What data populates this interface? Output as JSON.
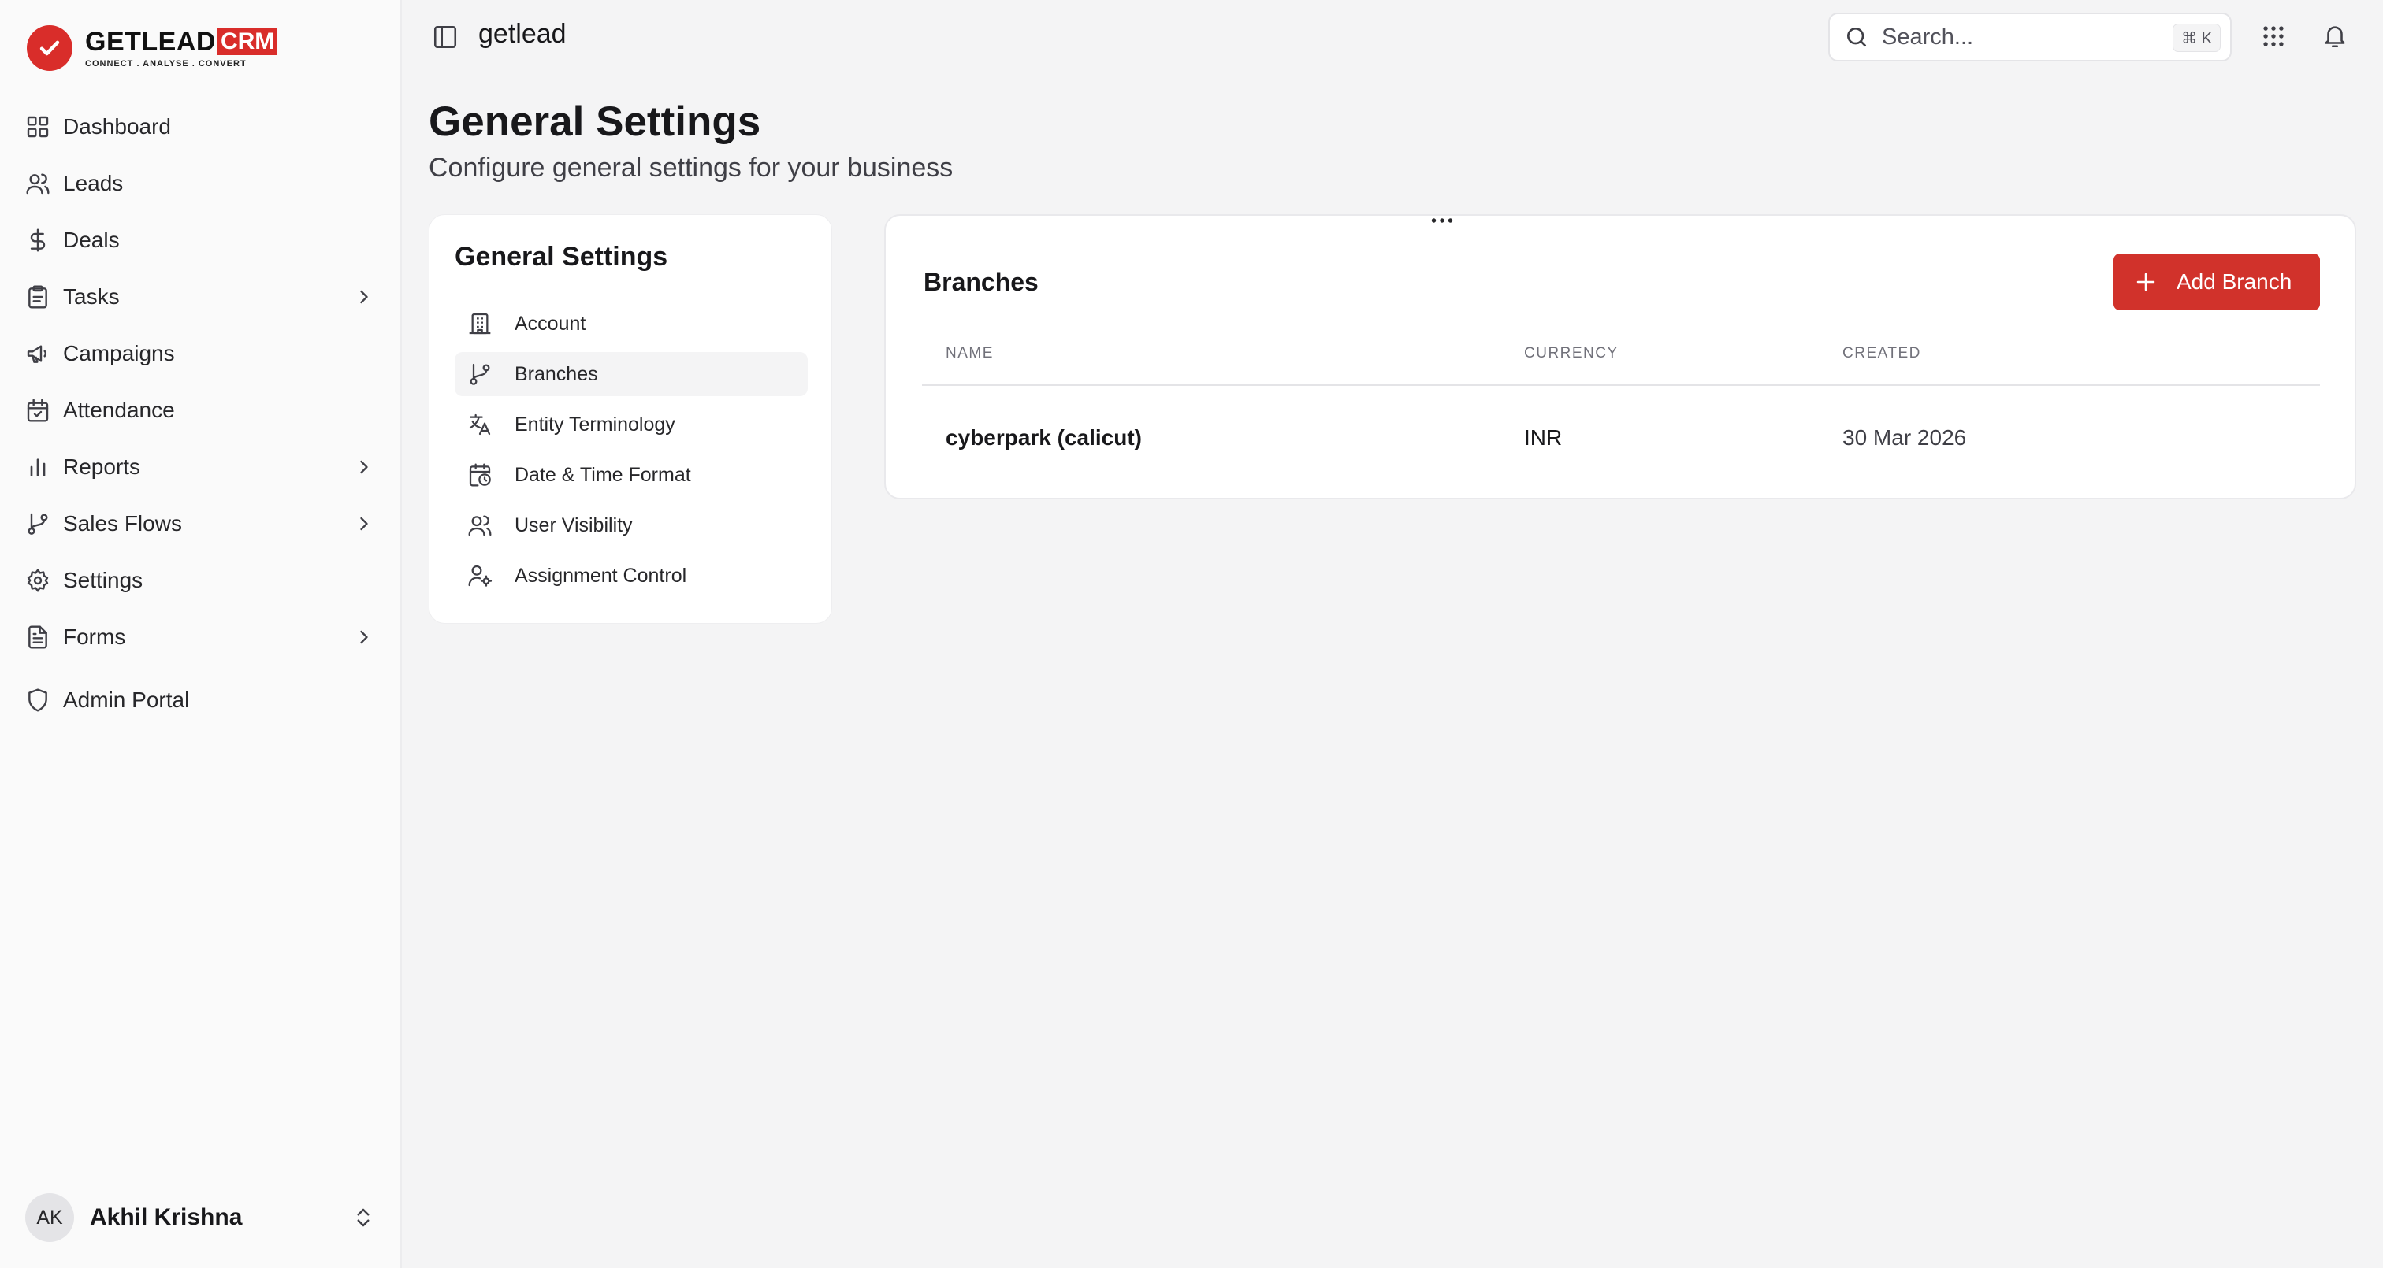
{
  "brand": {
    "name_main": "GETLEAD",
    "name_suffix": "CRM",
    "tagline": "CONNECT  .  ANALYSE  .  CONVERT",
    "accent_color": "#d92d2a"
  },
  "sidebar": {
    "items": [
      {
        "label": "Dashboard",
        "icon": "dashboard-grid-icon",
        "has_submenu": false
      },
      {
        "label": "Leads",
        "icon": "users-icon",
        "has_submenu": false
      },
      {
        "label": "Deals",
        "icon": "dollar-icon",
        "has_submenu": false
      },
      {
        "label": "Tasks",
        "icon": "clipboard-icon",
        "has_submenu": true
      },
      {
        "label": "Campaigns",
        "icon": "megaphone-icon",
        "has_submenu": false
      },
      {
        "label": "Attendance",
        "icon": "calendar-check-icon",
        "has_submenu": false
      },
      {
        "label": "Reports",
        "icon": "bar-chart-icon",
        "has_submenu": true
      },
      {
        "label": "Sales Flows",
        "icon": "git-branch-icon",
        "has_submenu": true
      },
      {
        "label": "Settings",
        "icon": "gear-icon",
        "has_submenu": false
      },
      {
        "label": "Forms",
        "icon": "file-text-icon",
        "has_submenu": true
      },
      {
        "label": "Admin Portal",
        "icon": "shield-icon",
        "has_submenu": false
      }
    ],
    "user": {
      "initials": "AK",
      "name": "Akhil Krishna"
    }
  },
  "topbar": {
    "workspace": "getlead",
    "search": {
      "placeholder": "Search...",
      "shortcut": "⌘ K"
    }
  },
  "page": {
    "title": "General Settings",
    "subtitle": "Configure general settings for your business"
  },
  "settings_menu": {
    "title": "General Settings",
    "items": [
      {
        "label": "Account",
        "icon": "building-icon",
        "active": false
      },
      {
        "label": "Branches",
        "icon": "git-branch-icon",
        "active": true
      },
      {
        "label": "Entity Terminology",
        "icon": "translate-icon",
        "active": false
      },
      {
        "label": "Date & Time Format",
        "icon": "calendar-clock-icon",
        "active": false
      },
      {
        "label": "User Visibility",
        "icon": "users-icon",
        "active": false
      },
      {
        "label": "Assignment Control",
        "icon": "user-cog-icon",
        "active": false
      }
    ]
  },
  "branches": {
    "title": "Branches",
    "add_button": "Add Branch",
    "columns": {
      "name": "NAME",
      "currency": "CURRENCY",
      "created": "CREATED"
    },
    "rows": [
      {
        "name": "cyberpark (calicut)",
        "currency": "INR",
        "created": "30 Mar 2026"
      }
    ]
  }
}
